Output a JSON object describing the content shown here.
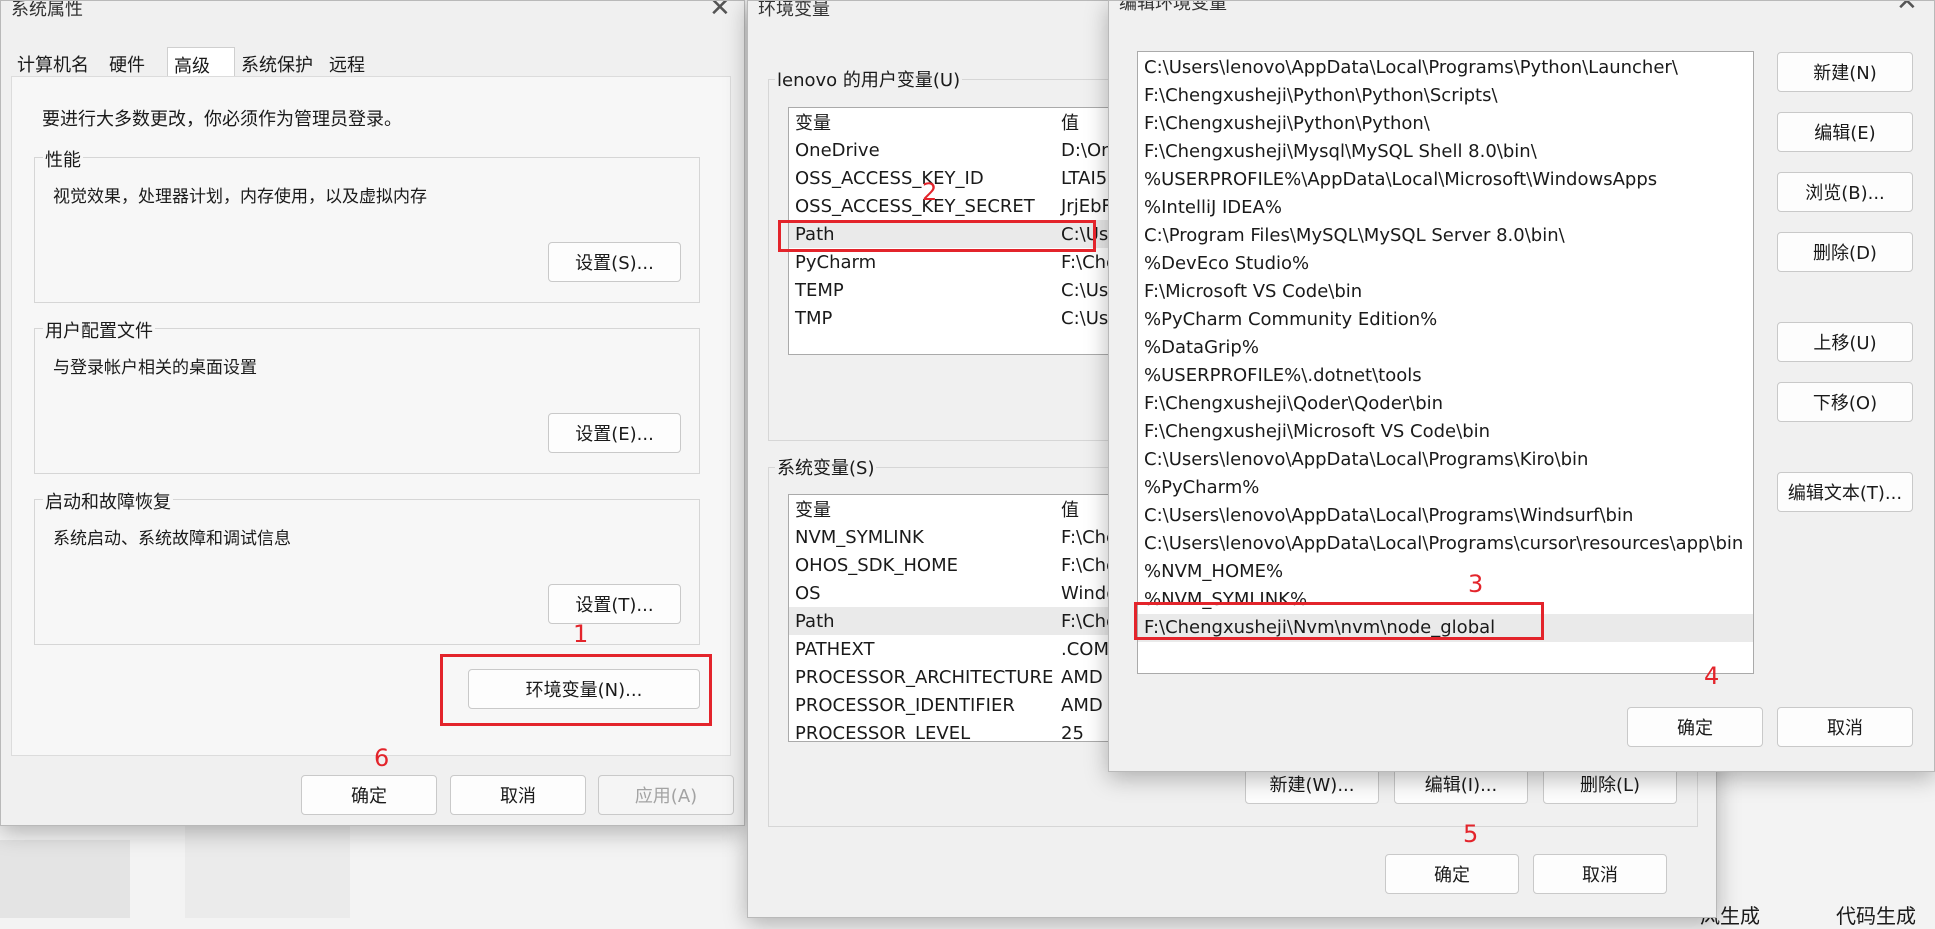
{
  "sys_props": {
    "title": "系统属性",
    "tabs": [
      "计算机名",
      "硬件",
      "高级",
      "系统保护",
      "远程"
    ],
    "admin_note": "要进行大多数更改，你必须作为管理员登录。",
    "performance": {
      "label": "性能",
      "desc": "视觉效果，处理器计划，内存使用，以及虚拟内存",
      "button": "设置(S)..."
    },
    "user_profile": {
      "label": "用户配置文件",
      "desc": "与登录帐户相关的桌面设置",
      "button": "设置(E)..."
    },
    "startup": {
      "label": "启动和故障恢复",
      "desc": "系统启动、系统故障和调试信息",
      "button": "设置(T)..."
    },
    "env_button": "环境变量(N)...",
    "ok": "确定",
    "cancel": "取消",
    "apply": "应用(A)"
  },
  "env_vars": {
    "title": "环境变量",
    "user_section": "lenovo 的用户变量(U)",
    "headers": {
      "name": "变量",
      "value": "值"
    },
    "user_vars": [
      {
        "name": "OneDrive",
        "value": "D:\\On"
      },
      {
        "name": "OSS_ACCESS_KEY_ID",
        "value": "LTAI5"
      },
      {
        "name": "OSS_ACCESS_KEY_SECRET",
        "value": "JrjEbF"
      },
      {
        "name": "Path",
        "value": "C:\\Use"
      },
      {
        "name": "PyCharm",
        "value": "F:\\Che"
      },
      {
        "name": "TEMP",
        "value": "C:\\Use"
      },
      {
        "name": "TMP",
        "value": "C:\\Use"
      }
    ],
    "system_section": "系统变量(S)",
    "system_vars": [
      {
        "name": "NVM_SYMLINK",
        "value": "F:\\Che"
      },
      {
        "name": "OHOS_SDK_HOME",
        "value": "F:\\Che"
      },
      {
        "name": "OS",
        "value": "Windo"
      },
      {
        "name": "Path",
        "value": "F:\\Che"
      },
      {
        "name": "PATHEXT",
        "value": ".COM"
      },
      {
        "name": "PROCESSOR_ARCHITECTURE",
        "value": "AMD"
      },
      {
        "name": "PROCESSOR_IDENTIFIER",
        "value": "AMD"
      },
      {
        "name": "PROCESSOR_LEVEL",
        "value": "25"
      }
    ],
    "new_btn": "新建(W)...",
    "edit_btn": "编辑(I)...",
    "delete_btn": "删除(L)",
    "ok": "确定",
    "cancel": "取消"
  },
  "edit_env": {
    "title": "编辑环境变量",
    "entries": [
      "C:\\Users\\lenovo\\AppData\\Local\\Programs\\Python\\Launcher\\",
      "F:\\Chengxusheji\\Python\\Python\\Scripts\\",
      "F:\\Chengxusheji\\Python\\Python\\",
      "F:\\Chengxusheji\\Mysql\\MySQL Shell 8.0\\bin\\",
      "%USERPROFILE%\\AppData\\Local\\Microsoft\\WindowsApps",
      "%IntelliJ IDEA%",
      "C:\\Program Files\\MySQL\\MySQL Server 8.0\\bin\\",
      "%DevEco Studio%",
      "F:\\Microsoft VS Code\\bin",
      "%PyCharm Community Edition%",
      "%DataGrip%",
      "%USERPROFILE%\\.dotnet\\tools",
      "F:\\Chengxusheji\\Qoder\\Qoder\\bin",
      "F:\\Chengxusheji\\Microsoft VS Code\\bin",
      "C:\\Users\\lenovo\\AppData\\Local\\Programs\\Kiro\\bin",
      "%PyCharm%",
      "C:\\Users\\lenovo\\AppData\\Local\\Programs\\Windsurf\\bin",
      "C:\\Users\\lenovo\\AppData\\Local\\Programs\\cursor\\resources\\app\\bin",
      "%NVM_HOME%",
      "%NVM_SYMLINK%",
      "F:\\Chengxusheji\\Nvm\\nvm\\node_global"
    ],
    "buttons": {
      "new": "新建(N)",
      "edit": "编辑(E)",
      "browse": "浏览(B)...",
      "delete": "删除(D)",
      "up": "上移(U)",
      "down": "下移(O)",
      "edit_text": "编辑文本(T)..."
    },
    "ok": "确定",
    "cancel": "取消"
  },
  "annotations": [
    "1",
    "2",
    "3",
    "4",
    "5",
    "6"
  ],
  "background": {
    "bottom_right_a": "风生成",
    "bottom_right_b": "代码生成"
  }
}
